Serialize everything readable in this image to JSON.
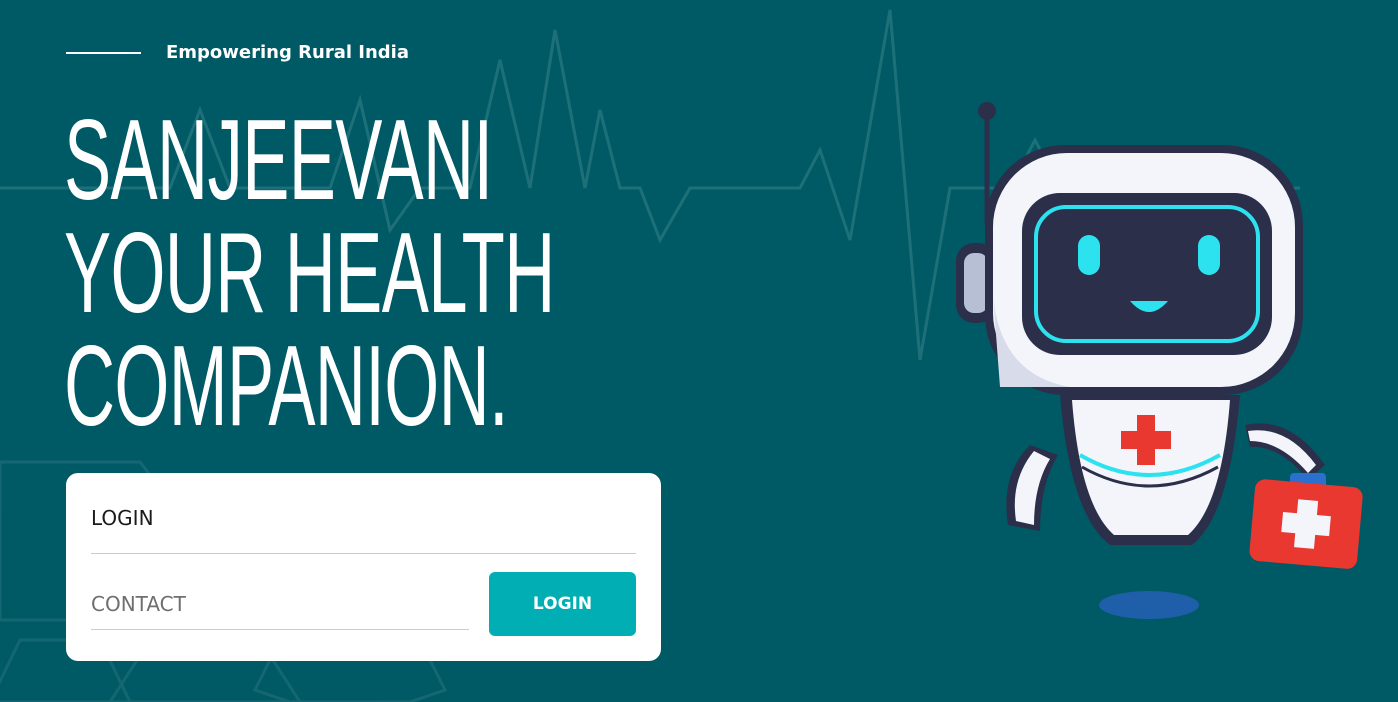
{
  "header": {
    "tagline": "Empowering Rural India"
  },
  "hero": {
    "line1": "SANJEEVANI",
    "line2": "YOUR HEALTH",
    "line3": "COMPANION."
  },
  "login_form": {
    "heading": "LOGIN",
    "contact_placeholder": "CONTACT",
    "contact_value": "",
    "submit_label": "LOGIN"
  },
  "illustration": {
    "icon": "robot-doctor-icon"
  },
  "colors": {
    "background": "#005a66",
    "accent": "#00aeb3",
    "robot_eye": "#2de2ef",
    "medical_red": "#e8382f"
  }
}
